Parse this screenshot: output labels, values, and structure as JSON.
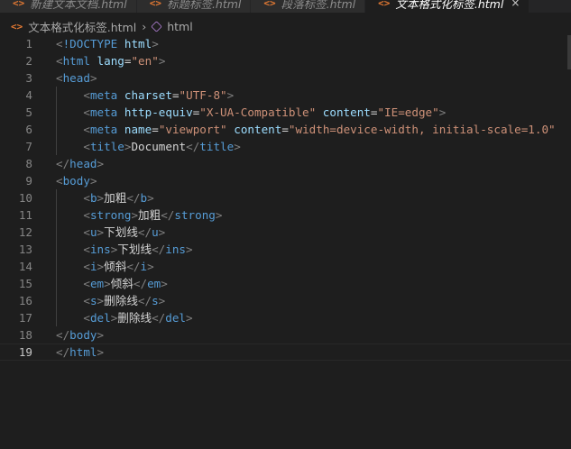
{
  "tabs": [
    {
      "label": "新建文本文档.html",
      "active": false
    },
    {
      "label": "标题标签.html",
      "active": false
    },
    {
      "label": "段落标签.html",
      "active": false
    },
    {
      "label": "文本格式化标签.html",
      "active": true
    }
  ],
  "tab_close_glyph": "×",
  "breadcrumb": {
    "file": "文本格式化标签.html",
    "node": "html"
  },
  "code_lines": [
    {
      "n": "1",
      "tokens": [
        [
          "p",
          "<"
        ],
        [
          "t",
          "!DOCTYPE"
        ],
        [
          "x",
          " "
        ],
        [
          "a",
          "html"
        ],
        [
          "p",
          ">"
        ]
      ]
    },
    {
      "n": "2",
      "tokens": [
        [
          "p",
          "<"
        ],
        [
          "t",
          "html"
        ],
        [
          "x",
          " "
        ],
        [
          "a",
          "lang"
        ],
        [
          "x",
          "="
        ],
        [
          "s",
          "\"en\""
        ],
        [
          "p",
          ">"
        ]
      ]
    },
    {
      "n": "3",
      "tokens": [
        [
          "p",
          "<"
        ],
        [
          "t",
          "head"
        ],
        [
          "p",
          ">"
        ]
      ]
    },
    {
      "n": "4",
      "tokens": [
        [
          "x",
          "    "
        ],
        [
          "p",
          "<"
        ],
        [
          "t",
          "meta"
        ],
        [
          "x",
          " "
        ],
        [
          "a",
          "charset"
        ],
        [
          "x",
          "="
        ],
        [
          "s",
          "\"UTF-8\""
        ],
        [
          "p",
          ">"
        ]
      ]
    },
    {
      "n": "5",
      "tokens": [
        [
          "x",
          "    "
        ],
        [
          "p",
          "<"
        ],
        [
          "t",
          "meta"
        ],
        [
          "x",
          " "
        ],
        [
          "a",
          "http-equiv"
        ],
        [
          "x",
          "="
        ],
        [
          "s",
          "\"X-UA-Compatible\""
        ],
        [
          "x",
          " "
        ],
        [
          "a",
          "content"
        ],
        [
          "x",
          "="
        ],
        [
          "s",
          "\"IE=edge\""
        ],
        [
          "p",
          ">"
        ]
      ]
    },
    {
      "n": "6",
      "tokens": [
        [
          "x",
          "    "
        ],
        [
          "p",
          "<"
        ],
        [
          "t",
          "meta"
        ],
        [
          "x",
          " "
        ],
        [
          "a",
          "name"
        ],
        [
          "x",
          "="
        ],
        [
          "s",
          "\"viewport\""
        ],
        [
          "x",
          " "
        ],
        [
          "a",
          "content"
        ],
        [
          "x",
          "="
        ],
        [
          "s",
          "\"width=device-width, initial-scale=1.0\""
        ]
      ]
    },
    {
      "n": "7",
      "tokens": [
        [
          "x",
          "    "
        ],
        [
          "p",
          "<"
        ],
        [
          "t",
          "title"
        ],
        [
          "p",
          ">"
        ],
        [
          "x",
          "Document"
        ],
        [
          "p",
          "</"
        ],
        [
          "t",
          "title"
        ],
        [
          "p",
          ">"
        ]
      ]
    },
    {
      "n": "8",
      "tokens": [
        [
          "p",
          "</"
        ],
        [
          "t",
          "head"
        ],
        [
          "p",
          ">"
        ]
      ]
    },
    {
      "n": "9",
      "tokens": [
        [
          "p",
          "<"
        ],
        [
          "t",
          "body"
        ],
        [
          "p",
          ">"
        ]
      ]
    },
    {
      "n": "10",
      "tokens": [
        [
          "x",
          "    "
        ],
        [
          "p",
          "<"
        ],
        [
          "t",
          "b"
        ],
        [
          "p",
          ">"
        ],
        [
          "x",
          "加粗"
        ],
        [
          "p",
          "</"
        ],
        [
          "t",
          "b"
        ],
        [
          "p",
          ">"
        ]
      ]
    },
    {
      "n": "11",
      "tokens": [
        [
          "x",
          "    "
        ],
        [
          "p",
          "<"
        ],
        [
          "t",
          "strong"
        ],
        [
          "p",
          ">"
        ],
        [
          "x",
          "加粗"
        ],
        [
          "p",
          "</"
        ],
        [
          "t",
          "strong"
        ],
        [
          "p",
          ">"
        ]
      ]
    },
    {
      "n": "12",
      "tokens": [
        [
          "x",
          "    "
        ],
        [
          "p",
          "<"
        ],
        [
          "t",
          "u"
        ],
        [
          "p",
          ">"
        ],
        [
          "x",
          "下划线"
        ],
        [
          "p",
          "</"
        ],
        [
          "t",
          "u"
        ],
        [
          "p",
          ">"
        ]
      ]
    },
    {
      "n": "13",
      "tokens": [
        [
          "x",
          "    "
        ],
        [
          "p",
          "<"
        ],
        [
          "t",
          "ins"
        ],
        [
          "p",
          ">"
        ],
        [
          "x",
          "下划线"
        ],
        [
          "p",
          "</"
        ],
        [
          "t",
          "ins"
        ],
        [
          "p",
          ">"
        ]
      ]
    },
    {
      "n": "14",
      "tokens": [
        [
          "x",
          "    "
        ],
        [
          "p",
          "<"
        ],
        [
          "t",
          "i"
        ],
        [
          "p",
          ">"
        ],
        [
          "x",
          "倾斜"
        ],
        [
          "p",
          "</"
        ],
        [
          "t",
          "i"
        ],
        [
          "p",
          ">"
        ]
      ]
    },
    {
      "n": "15",
      "tokens": [
        [
          "x",
          "    "
        ],
        [
          "p",
          "<"
        ],
        [
          "t",
          "em"
        ],
        [
          "p",
          ">"
        ],
        [
          "x",
          "倾斜"
        ],
        [
          "p",
          "</"
        ],
        [
          "t",
          "em"
        ],
        [
          "p",
          ">"
        ]
      ]
    },
    {
      "n": "16",
      "tokens": [
        [
          "x",
          "    "
        ],
        [
          "p",
          "<"
        ],
        [
          "t",
          "s"
        ],
        [
          "p",
          ">"
        ],
        [
          "x",
          "删除线"
        ],
        [
          "p",
          "</"
        ],
        [
          "t",
          "s"
        ],
        [
          "p",
          ">"
        ]
      ]
    },
    {
      "n": "17",
      "tokens": [
        [
          "x",
          "    "
        ],
        [
          "p",
          "<"
        ],
        [
          "t",
          "del"
        ],
        [
          "p",
          ">"
        ],
        [
          "x",
          "删除线"
        ],
        [
          "p",
          "</"
        ],
        [
          "t",
          "del"
        ],
        [
          "p",
          ">"
        ]
      ]
    },
    {
      "n": "18",
      "tokens": [
        [
          "p",
          "</"
        ],
        [
          "t",
          "body"
        ],
        [
          "p",
          ">"
        ]
      ]
    },
    {
      "n": "19",
      "tokens": [
        [
          "p",
          "</"
        ],
        [
          "t",
          "html"
        ],
        [
          "p",
          ">"
        ]
      ],
      "current": true
    }
  ],
  "colors": {
    "background": "#1e1e1e",
    "tag": "#569cd6",
    "attribute": "#9cdcfe",
    "string": "#ce9178",
    "punctuation": "#808080",
    "text": "#d4d4d4",
    "html_icon": "#e37933"
  },
  "icons": {
    "tab_file": "html-file-icon",
    "breadcrumb_file": "html-file-icon",
    "breadcrumb_node": "element-symbol-icon",
    "close": "close-icon"
  }
}
